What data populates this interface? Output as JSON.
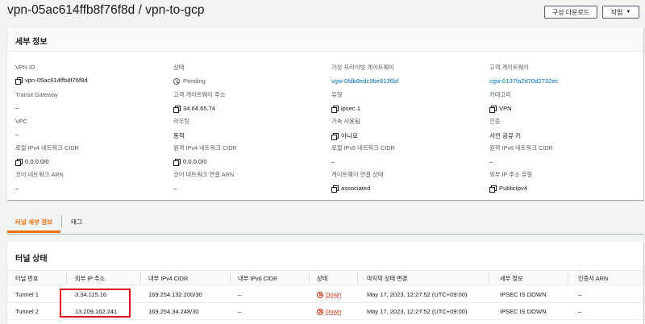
{
  "header": {
    "title": "vpn-05ac614ffb8f76f8d / vpn-to-gcp",
    "download_label": "구성 다운로드",
    "actions_label": "작업"
  },
  "details": {
    "title": "세부 정보",
    "vpn_id": {
      "label": "VPN ID",
      "value": "vpn-05ac614ffb8f76f8d"
    },
    "state": {
      "label": "상태",
      "value": "Pending"
    },
    "vgw": {
      "label": "가상 프라이빗 게이트웨이",
      "value": "vgw-0fdb8edc9be8136bf"
    },
    "cgw": {
      "label": "고객 게이트웨이",
      "value": "cgw-0137fa2d70d2732ec"
    },
    "tgw": {
      "label": "Transit Gateway",
      "value": "–"
    },
    "cgw_address": {
      "label": "고객 게이트웨이 주소",
      "value": "34.64.65.74"
    },
    "type": {
      "label": "유형",
      "value": "ipsec.1"
    },
    "category": {
      "label": "카테고리",
      "value": "VPN"
    },
    "vpc": {
      "label": "VPC",
      "value": "–"
    },
    "routing": {
      "label": "라우팅",
      "value": "동적"
    },
    "acceleration": {
      "label": "가속 사용됨",
      "value": "아니요"
    },
    "auth": {
      "label": "인증",
      "value": "사전 공유 키"
    },
    "local_ipv4": {
      "label": "로컬 IPv4 네트워크 CIDR",
      "value": "0.0.0.0/0"
    },
    "remote_ipv4": {
      "label": "원격 IPv4 네트워크 CIDR",
      "value": "0.0.0.0/0"
    },
    "local_ipv6": {
      "label": "로컬 IPv6 네트워크 CIDR",
      "value": "–"
    },
    "remote_ipv6": {
      "label": "원격 IPv6 네트워크 CIDR",
      "value": "–"
    },
    "core_arn": {
      "label": "코어 네트워크 ARN",
      "value": "–"
    },
    "core_attach_arn": {
      "label": "코어 네트워크 연결 ARN",
      "value": "–"
    },
    "gw_attach_state": {
      "label": "게이트웨이 연결 상태",
      "value": "associated"
    },
    "outside_ip_type": {
      "label": "외부 IP 주소 유형",
      "value": "PublicIpv4"
    }
  },
  "tabs": {
    "tunnel_details": "터널 세부 정보",
    "tags": "태그"
  },
  "tunnels": {
    "title": "터널 상태",
    "columns": [
      "터널 번호",
      "외부 IP 주소",
      "내부 IPv4 CIDR",
      "내부 IPv6 CIDR",
      "상태",
      "마지막 상태 변경",
      "세부 정보",
      "인증서 ARN"
    ],
    "rows": [
      {
        "name": "Tunnel 1",
        "outside_ip": "3.34.115.16",
        "inside_ipv4": "169.254.132.200/30",
        "inside_ipv6": "–",
        "status": "Down",
        "last_change": "May 17, 2023, 12:27:52 (UTC+09:00)",
        "details": "IPSEC IS DOWN",
        "cert_arn": "–"
      },
      {
        "name": "Tunnel 2",
        "outside_ip": "13.209.162.241",
        "inside_ipv4": "169.254.34.248/30",
        "inside_ipv6": "–",
        "status": "Down",
        "last_change": "May 17, 2023, 12:27:52 (UTC+09:00)",
        "details": "IPSEC IS DOWN",
        "cert_arn": "–"
      }
    ]
  },
  "colors": {
    "link": "#0073bb",
    "accent": "#ec7211",
    "error": "#d13212",
    "highlight": "#e0121b"
  }
}
